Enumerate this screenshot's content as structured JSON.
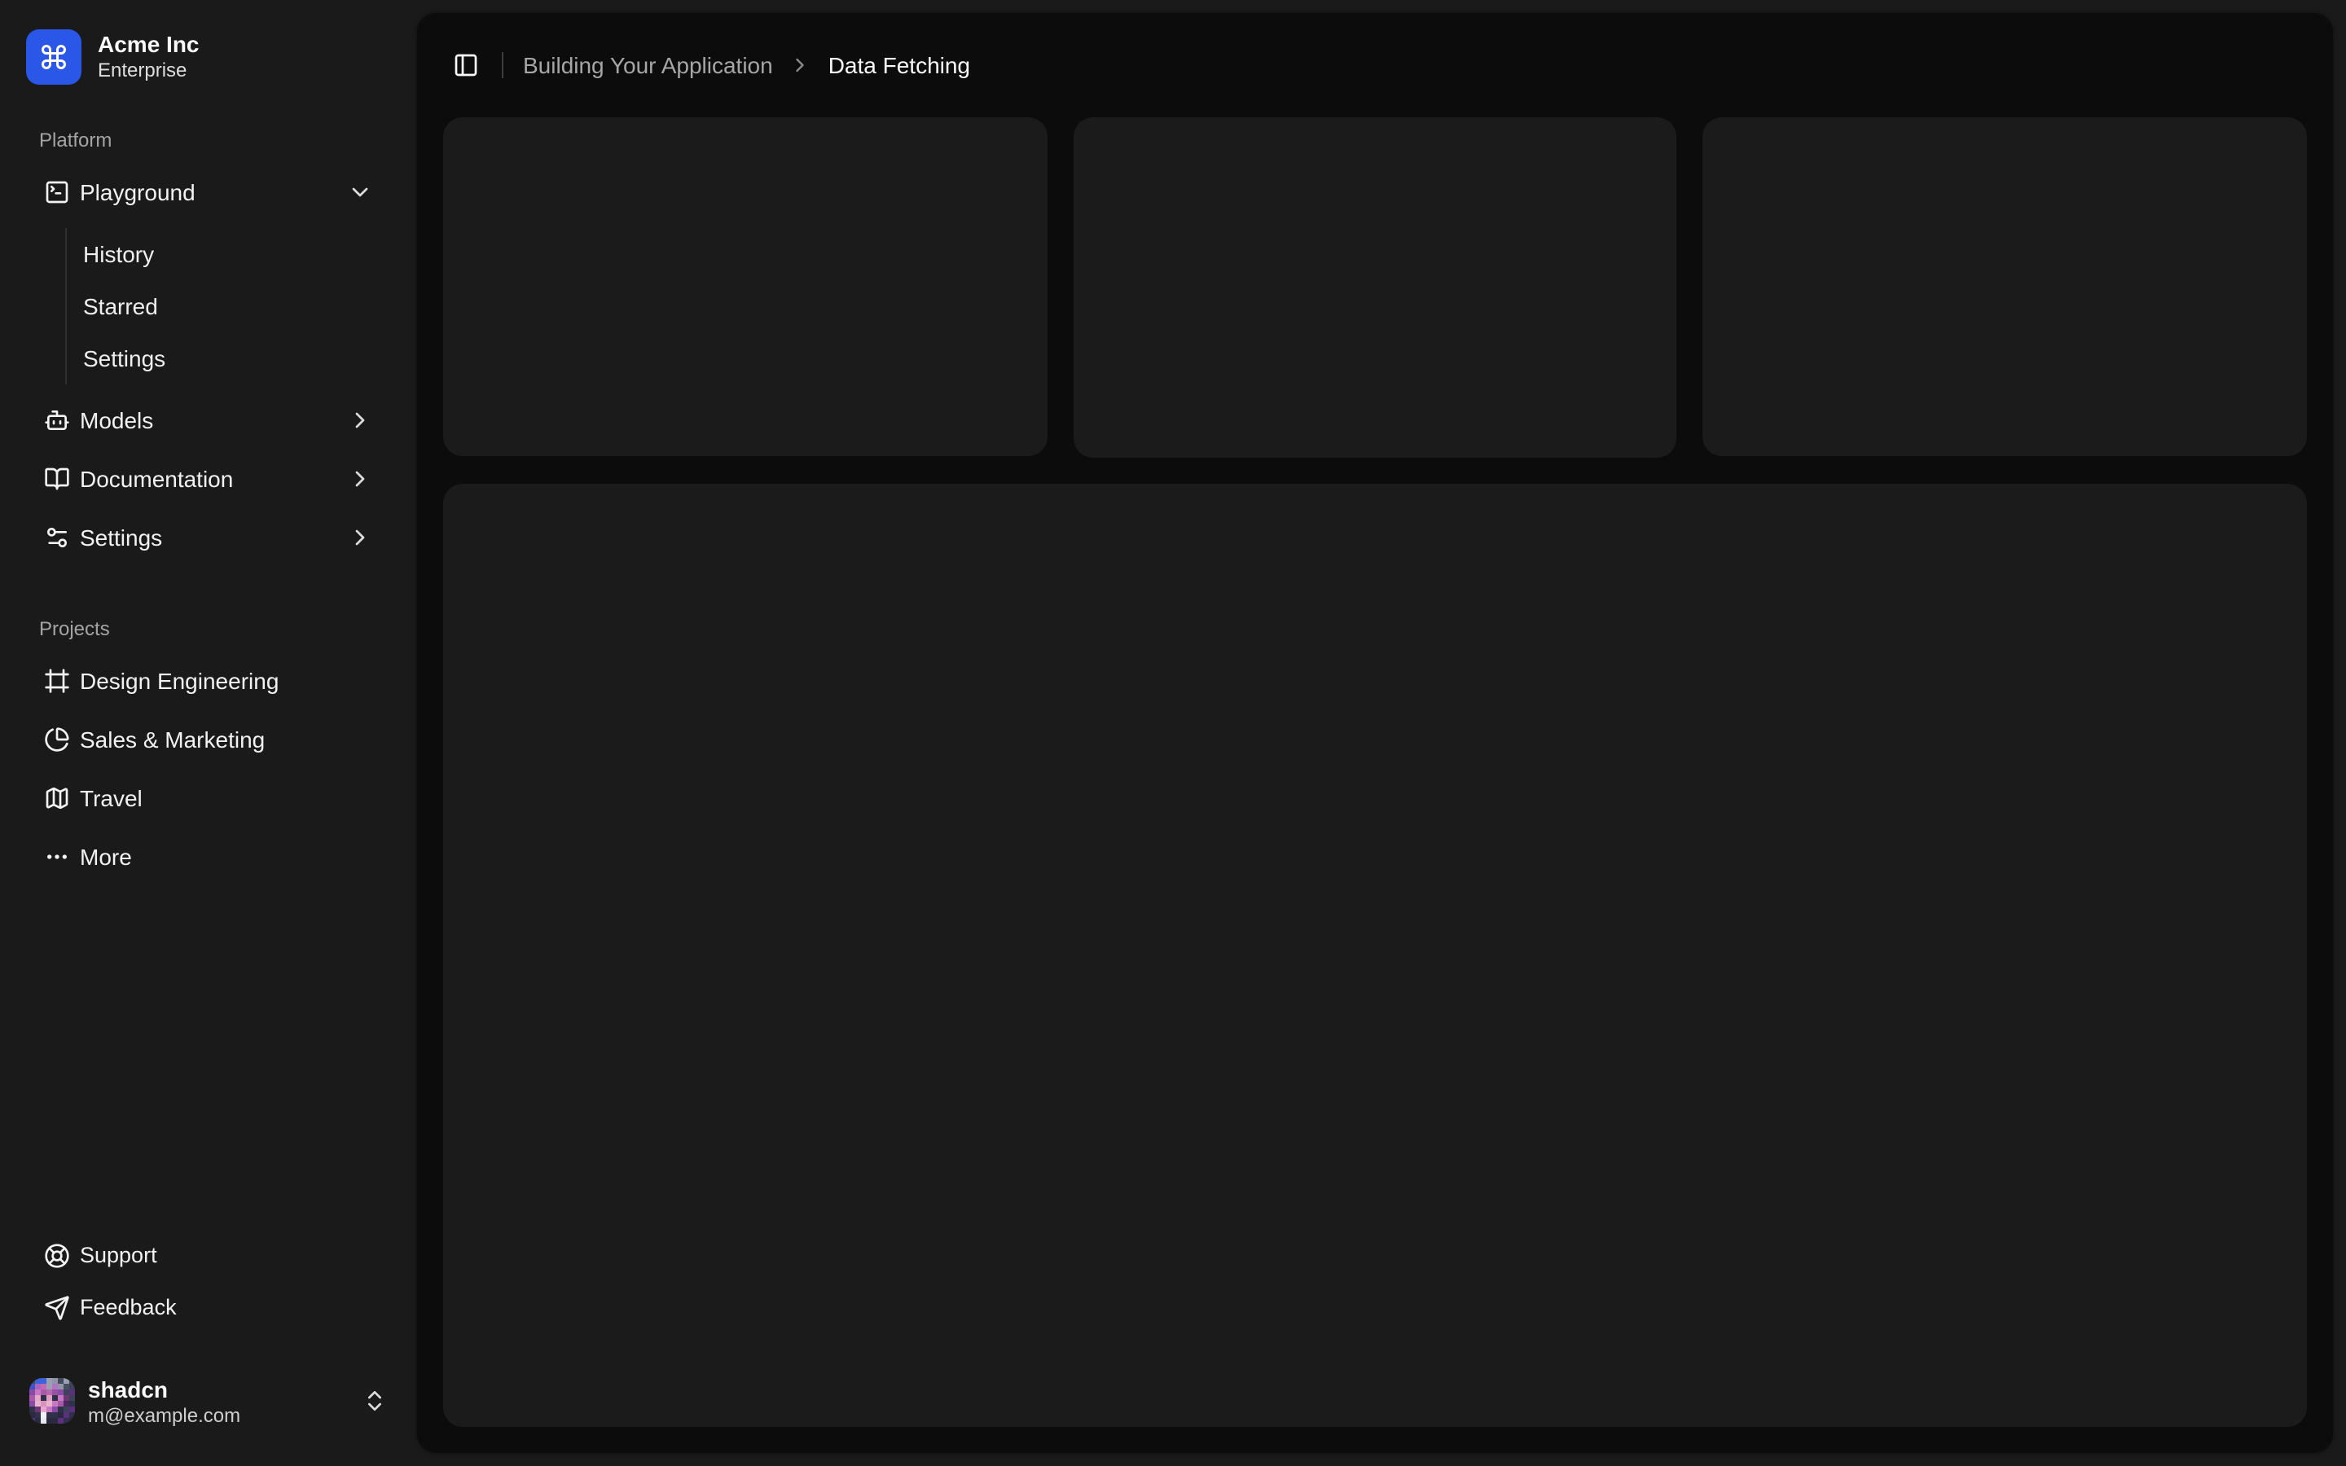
{
  "brand": {
    "name": "Acme Inc",
    "plan": "Enterprise",
    "logo_icon": "command-icon",
    "logo_bg": "#2a57e8"
  },
  "sidebar": {
    "groups": [
      {
        "label": "Platform",
        "items": [
          {
            "label": "Playground",
            "icon": "square-terminal-icon",
            "chevron": "chevron-down-icon",
            "expanded": true,
            "children": [
              {
                "label": "History"
              },
              {
                "label": "Starred"
              },
              {
                "label": "Settings"
              }
            ]
          },
          {
            "label": "Models",
            "icon": "bot-icon",
            "chevron": "chevron-right-icon"
          },
          {
            "label": "Documentation",
            "icon": "book-open-icon",
            "chevron": "chevron-right-icon"
          },
          {
            "label": "Settings",
            "icon": "sliders-icon",
            "chevron": "chevron-right-icon"
          }
        ]
      },
      {
        "label": "Projects",
        "items": [
          {
            "label": "Design Engineering",
            "icon": "frame-icon"
          },
          {
            "label": "Sales & Marketing",
            "icon": "pie-chart-icon"
          },
          {
            "label": "Travel",
            "icon": "map-icon"
          },
          {
            "label": "More",
            "icon": "ellipsis-icon"
          }
        ]
      }
    ],
    "secondary": [
      {
        "label": "Support",
        "icon": "life-buoy-icon"
      },
      {
        "label": "Feedback",
        "icon": "send-icon"
      }
    ],
    "user": {
      "name": "shadcn",
      "email": "m@example.com"
    }
  },
  "header": {
    "breadcrumb": {
      "parent": "Building Your Application",
      "current": "Data Fetching"
    }
  },
  "main": {
    "placeholder_cards": 3,
    "placeholder_big": 1
  },
  "colors": {
    "page_bg": "#1a1a1a",
    "inset_bg": "#0c0c0c",
    "card_bg": "#1b1b1b",
    "accent_blue": "#2a57e8",
    "text_primary": "#fafafa",
    "text_muted": "#a6a6a6"
  }
}
